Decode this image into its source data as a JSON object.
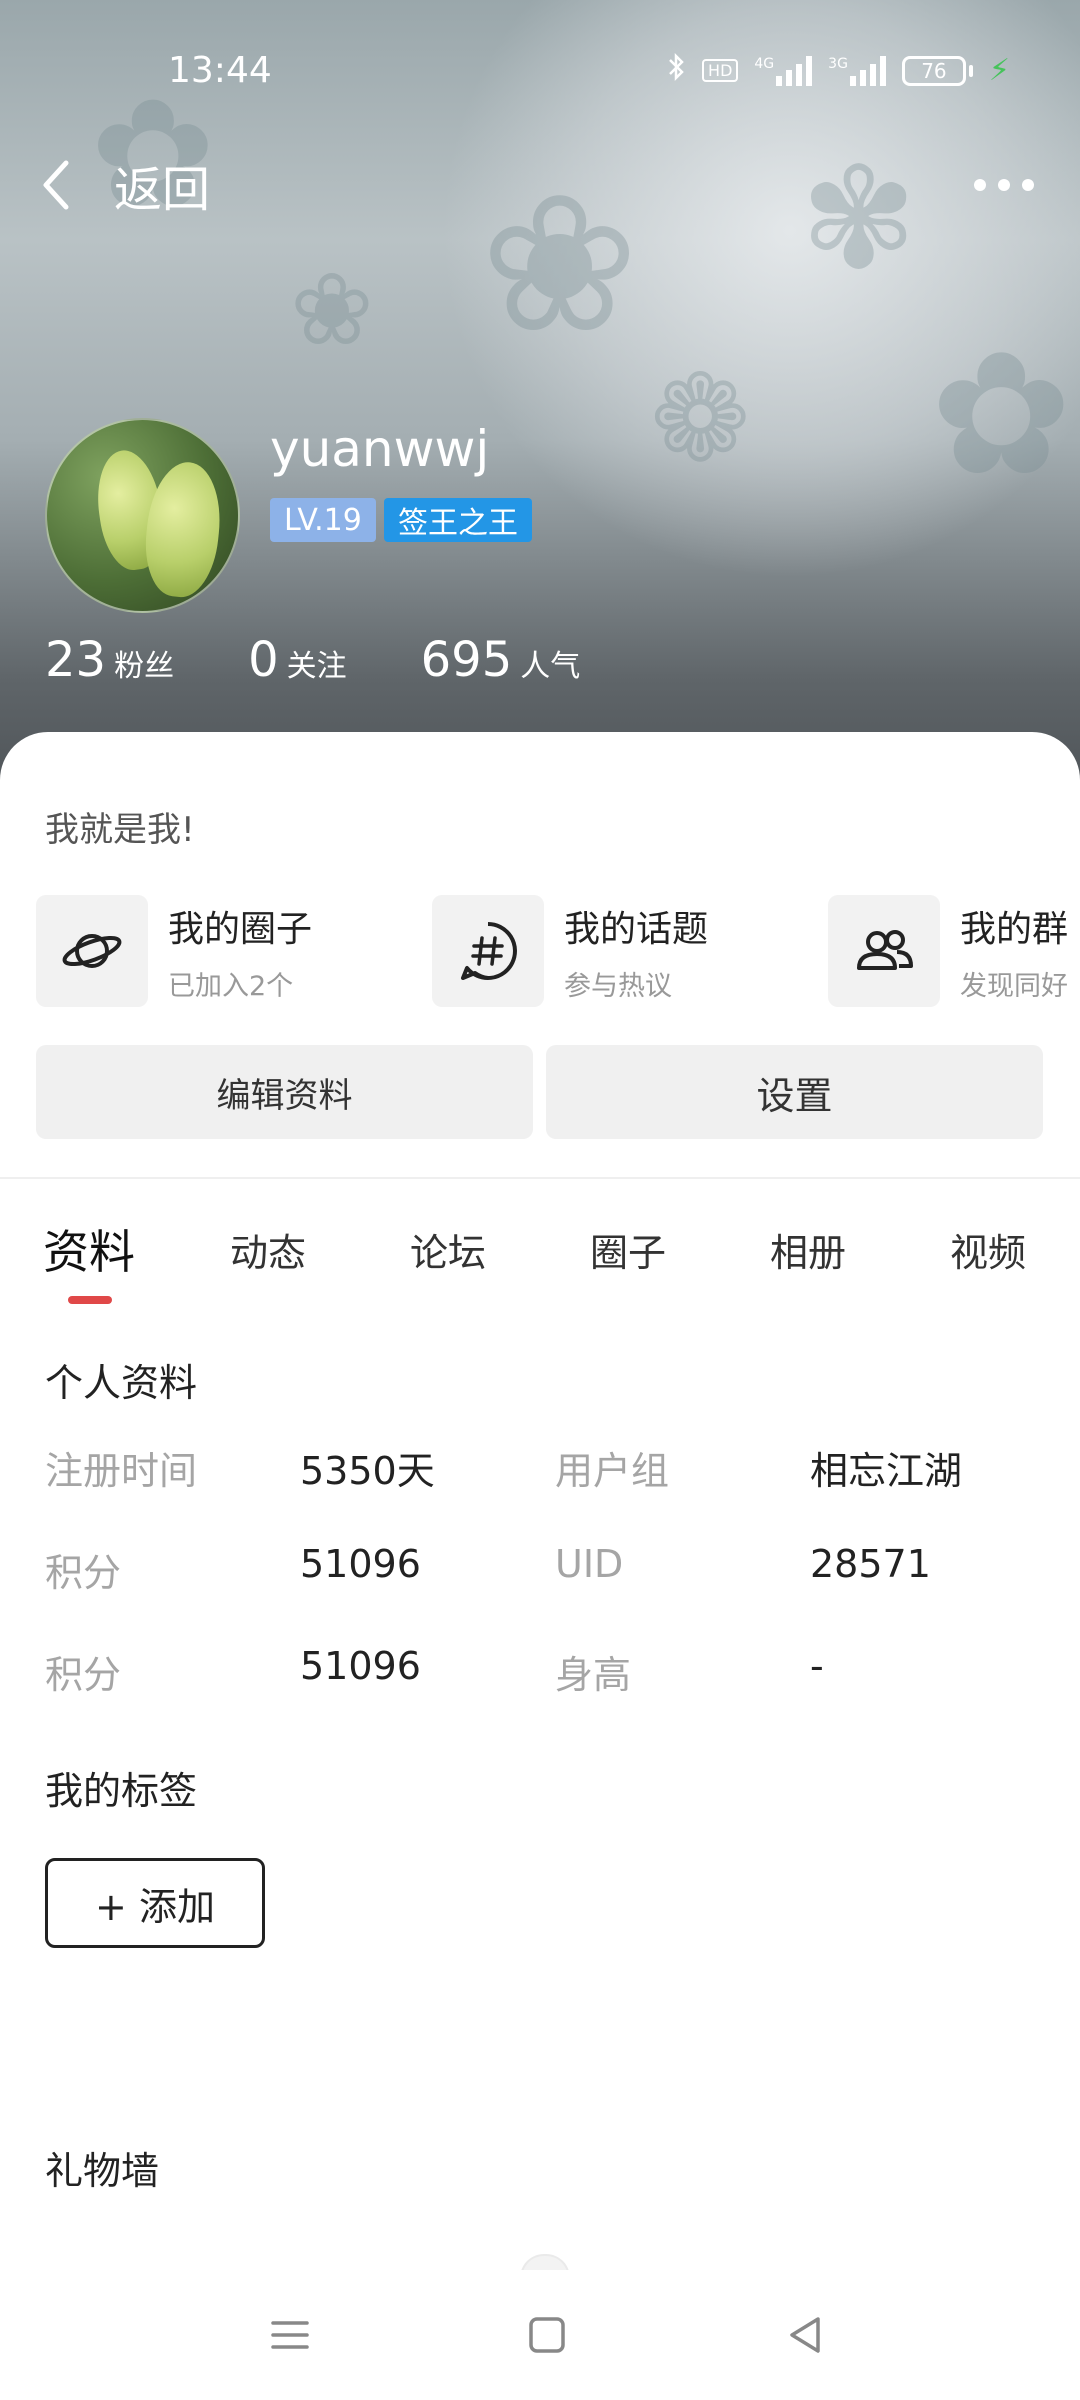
{
  "status_bar": {
    "time": "13:44",
    "bluetooth_icon": "bluetooth-icon",
    "hd_badge": "HD",
    "net_4g": "4G",
    "net_3g": "3G",
    "battery_level": "76",
    "charging_icon": "bolt-icon"
  },
  "header": {
    "back_label": "返回",
    "more_icon": "more-dots-icon"
  },
  "profile": {
    "username": "yuanwwj",
    "level": "LV.19",
    "title_badge": "签王之王",
    "stats": [
      {
        "value": "23",
        "label": "粉丝"
      },
      {
        "value": "0",
        "label": "关注"
      },
      {
        "value": "695",
        "label": "人气"
      }
    ],
    "bio": "我就是我!"
  },
  "shortcuts": [
    {
      "title": "我的圈子",
      "subtitle": "已加入2个",
      "icon": "planet-icon"
    },
    {
      "title": "我的话题",
      "subtitle": "参与热议",
      "icon": "hashtag-icon"
    },
    {
      "title": "我的群",
      "subtitle": "发现同好",
      "icon": "group-icon"
    }
  ],
  "actions": {
    "edit_label": "编辑资料",
    "settings_label": "设置"
  },
  "tabs": [
    "资料",
    "动态",
    "论坛",
    "圈子",
    "相册",
    "视频"
  ],
  "active_tab": "资料",
  "personal_info": {
    "title": "个人资料",
    "rows": [
      {
        "label1": "注册时间",
        "value1": "5350天",
        "label2": "用户组",
        "value2": "相忘江湖"
      },
      {
        "label1": "积分",
        "value1": "51096",
        "label2": "UID",
        "value2": "28571"
      },
      {
        "label1": "积分",
        "value1": "51096",
        "label2": "身高",
        "value2": "-"
      }
    ]
  },
  "tags": {
    "title": "我的标签",
    "add_label": "+ 添加"
  },
  "gift_wall": {
    "title": "礼物墙"
  },
  "nav_bar": {
    "menu_icon": "menu-icon",
    "home_icon": "home-square-icon",
    "back_icon": "back-triangle-icon"
  },
  "colors": {
    "accent_red": "#e04848",
    "level_badge": "#8db2e8",
    "title_badge": "#2396e6",
    "charging_green": "#46c35b"
  }
}
